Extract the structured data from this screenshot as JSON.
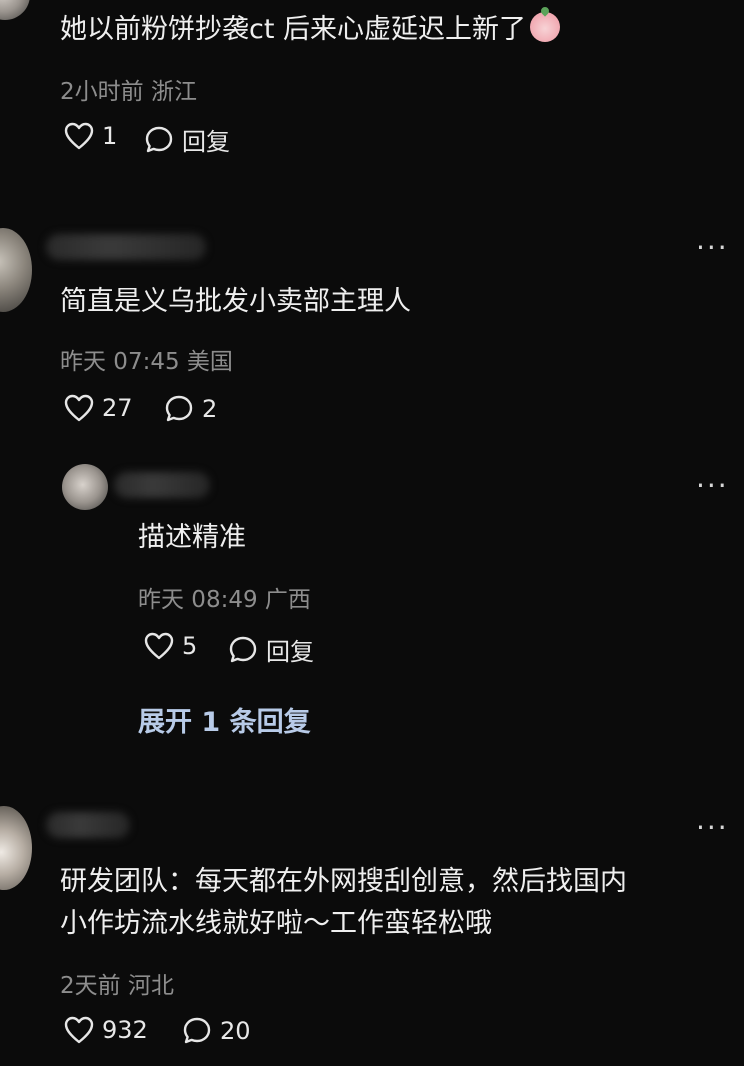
{
  "comments": [
    {
      "text": "她以前粉饼抄袭ct 后来心虚延迟上新了",
      "meta": "2小时前 浙江",
      "likes": "1",
      "reply_label": "回复"
    },
    {
      "text": "简直是义乌批发小卖部主理人",
      "meta": "昨天 07:45 美国",
      "likes": "27",
      "reply_count": "2"
    },
    {
      "text": "描述精准",
      "meta": "昨天 08:49 广西",
      "likes": "5",
      "reply_label": "回复",
      "expand_label": "展开 1 条回复"
    },
    {
      "text_line1": "研发团队：每天都在外网搜刮创意，然后找国内",
      "text_line2": "小作坊流水线就好啦～工作蛮轻松哦",
      "meta": "2天前 河北",
      "likes": "932",
      "reply_count": "20"
    }
  ],
  "more_label": "···",
  "colors": {
    "background": "#0b0b0b",
    "text": "#efefef",
    "meta": "#8d8d8d",
    "link": "#b8cbe8"
  }
}
